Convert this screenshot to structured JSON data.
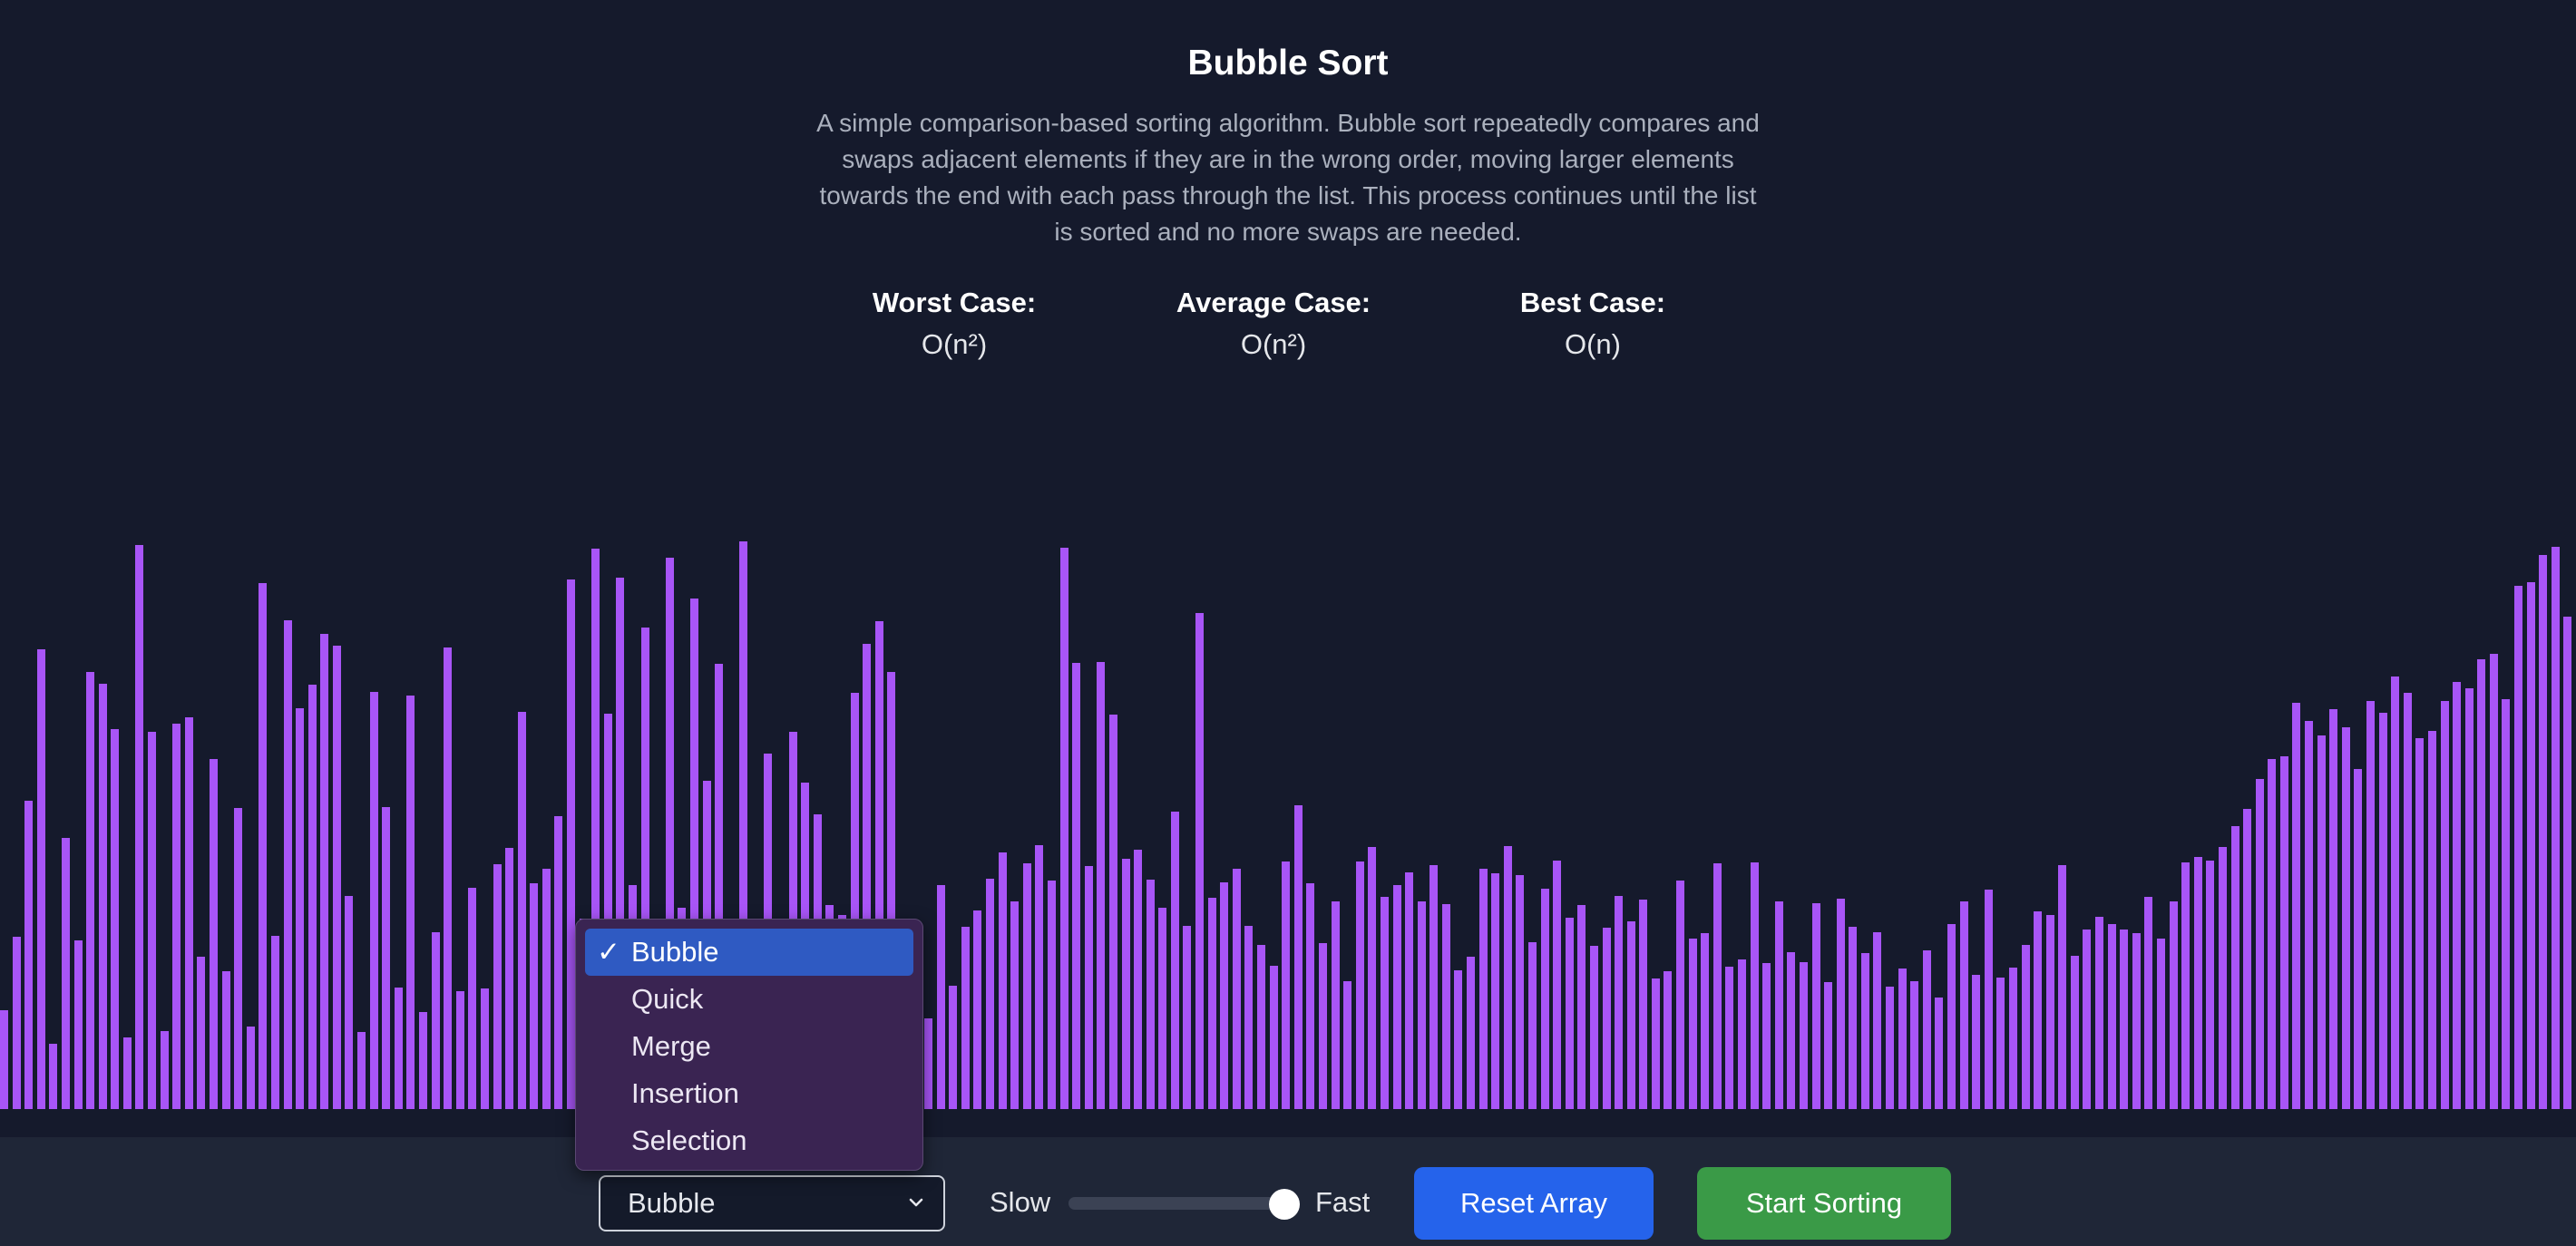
{
  "algorithm": {
    "title": "Bubble Sort",
    "description": "A simple comparison-based sorting algorithm. Bubble sort repeatedly compares and swaps adjacent elements if they are in the wrong order, moving larger elements towards the end with each pass through the list. This process continues until the list is sorted and no more swaps are needed.",
    "complexity": {
      "worst_label": "Worst Case:",
      "worst_value": "O(n²)",
      "average_label": "Average Case:",
      "average_value": "O(n²)",
      "best_label": "Best Case:",
      "best_value": "O(n)"
    }
  },
  "array": {
    "bar_color": "#a855f7",
    "max_value": 600,
    "values": [
      105,
      183,
      327,
      488,
      69,
      288,
      179,
      464,
      452,
      404,
      76,
      599,
      401,
      83,
      409,
      416,
      162,
      372,
      146,
      320,
      88,
      559,
      184,
      519,
      426,
      451,
      505,
      492,
      226,
      82,
      443,
      321,
      129,
      439,
      103,
      188,
      490,
      125,
      235,
      128,
      260,
      277,
      422,
      240,
      255,
      311,
      562,
      202,
      595,
      420,
      564,
      238,
      511,
      194,
      586,
      214,
      542,
      349,
      473,
      161,
      603,
      128,
      378,
      77,
      401,
      347,
      313,
      217,
      206,
      442,
      494,
      518,
      464,
      150,
      133,
      96,
      238,
      131,
      194,
      211,
      245,
      273,
      221,
      261,
      280,
      243,
      596,
      474,
      258,
      475,
      419,
      266,
      275,
      244,
      214,
      316,
      195,
      527,
      224,
      241,
      255,
      195,
      174,
      152,
      263,
      323,
      240,
      176,
      221,
      136,
      263,
      278,
      225,
      238,
      251,
      221,
      259,
      218,
      147,
      162,
      255,
      250,
      279,
      248,
      177,
      234,
      264,
      203,
      217,
      173,
      193,
      226,
      199,
      222,
      139,
      146,
      243,
      181,
      187,
      261,
      151,
      159,
      262,
      155,
      221,
      167,
      156,
      219,
      135,
      223,
      194,
      166,
      188,
      130,
      149,
      136,
      169,
      118,
      196,
      221,
      143,
      233,
      140,
      150,
      174,
      210,
      206,
      259,
      163,
      191,
      204,
      196,
      191,
      187,
      225,
      181,
      221,
      262,
      268,
      264,
      278,
      300,
      319,
      351,
      372,
      375,
      431,
      412,
      397,
      425,
      405,
      361,
      433,
      421,
      459,
      442,
      394,
      402,
      433,
      454,
      447,
      478,
      483,
      435,
      556,
      560,
      588,
      597,
      523
    ],
    "note": "values are in arbitrary height units relative to max_value"
  },
  "controls": {
    "algorithm_select": {
      "selected": "Bubble",
      "options": [
        "Bubble",
        "Quick",
        "Merge",
        "Insertion",
        "Selection"
      ],
      "check_glyph": "✓"
    },
    "speed": {
      "slow_label": "Slow",
      "fast_label": "Fast",
      "value_fraction": 0.9
    },
    "reset_label": "Reset Array",
    "start_label": "Start Sorting"
  }
}
